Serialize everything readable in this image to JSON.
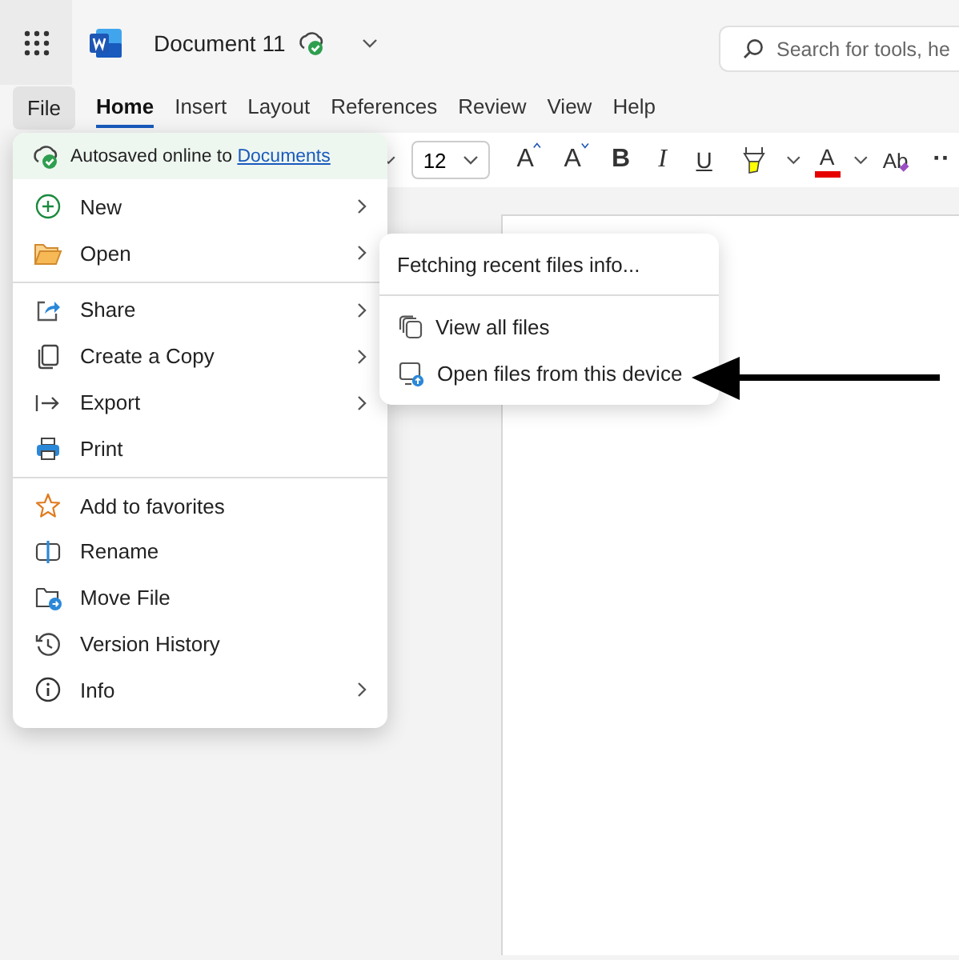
{
  "header": {
    "document_title": "Document 11",
    "saved": true,
    "search": {
      "placeholder": "Search for tools, he"
    }
  },
  "file_tab": {
    "label": "File",
    "open": true
  },
  "tabs": [
    {
      "label": "Home",
      "selected": true
    },
    {
      "label": "Insert",
      "selected": false
    },
    {
      "label": "Layout",
      "selected": false
    },
    {
      "label": "References",
      "selected": false
    },
    {
      "label": "Review",
      "selected": false
    },
    {
      "label": "View",
      "selected": false
    },
    {
      "label": "Help",
      "selected": false
    }
  ],
  "ribbon": {
    "font_size": "12",
    "buttons": [
      {
        "kind": "grow",
        "glyph": "A"
      },
      {
        "kind": "shrink",
        "glyph": "A"
      },
      {
        "kind": "bold",
        "glyph": "B"
      },
      {
        "kind": "italic",
        "glyph": "I"
      },
      {
        "kind": "underline",
        "glyph": "U"
      },
      {
        "kind": "highlight"
      },
      {
        "kind": "font-color",
        "glyph": "A",
        "color": "#e60000"
      },
      {
        "kind": "clear",
        "glyph": "Ab"
      },
      {
        "kind": "more",
        "glyph": "··"
      }
    ]
  },
  "file_menu": {
    "status": {
      "text": "Autosaved online to ",
      "link": "Documents"
    },
    "groups": [
      [
        {
          "label": "New",
          "submenu": true
        },
        {
          "label": "Open",
          "submenu": true
        }
      ],
      [
        {
          "label": "Share",
          "submenu": true
        },
        {
          "label": "Create a Copy",
          "submenu": true
        },
        {
          "label": "Export",
          "submenu": true
        },
        {
          "label": "Print",
          "submenu": false
        }
      ],
      [
        {
          "label": "Add to favorites",
          "submenu": false
        },
        {
          "label": "Rename",
          "submenu": false
        },
        {
          "label": "Move File",
          "submenu": false
        },
        {
          "label": "Version History",
          "submenu": false
        },
        {
          "label": "Info",
          "submenu": true
        }
      ]
    ]
  },
  "open_submenu": {
    "status": "Fetching recent files info...",
    "items": [
      {
        "label": "View all files"
      },
      {
        "label": "Open files from this device"
      }
    ]
  },
  "annotation": {
    "kind": "arrow"
  }
}
